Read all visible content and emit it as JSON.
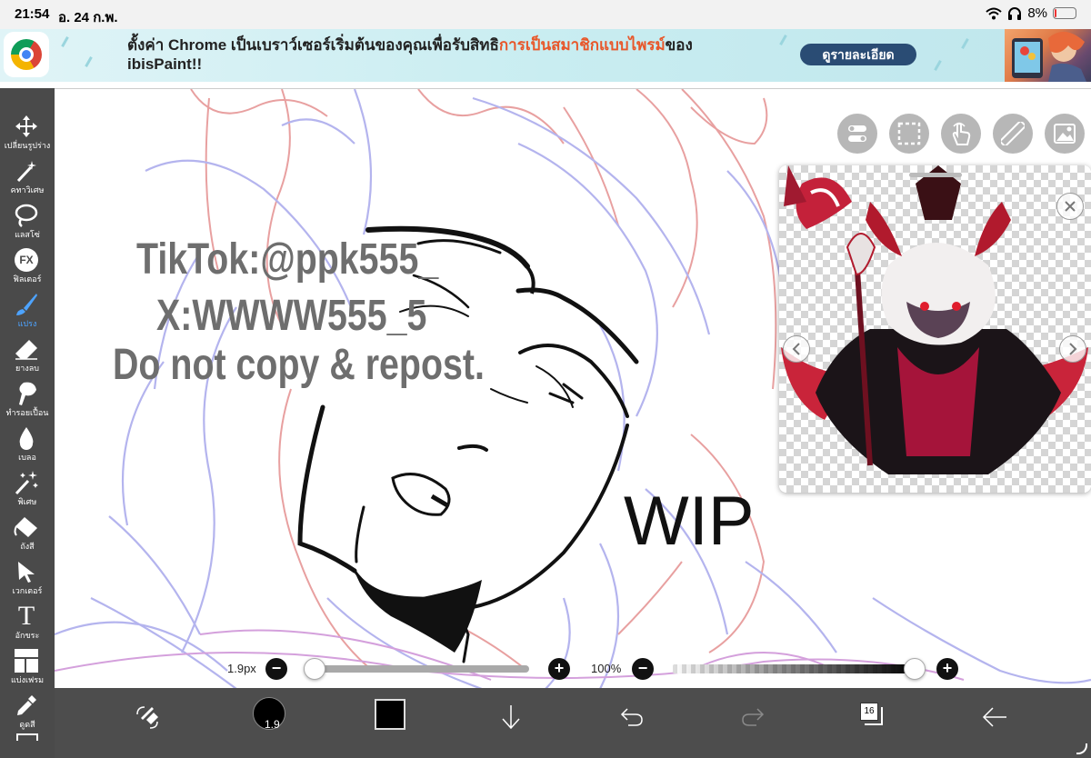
{
  "status_bar": {
    "time": "21:54",
    "date": "อ. 24 ก.พ.",
    "battery": "8%",
    "battery_level": 0.08
  },
  "ad_banner": {
    "text_part1": "ตั้งค่า Chrome เป็นเบราว์เซอร์เริ่มต้นของคุณเพื่อรับสิทธิ",
    "text_highlight": "การเป็นสมาชิกแบบไพรม์",
    "text_part2": "ของ",
    "text_line2": "ibisPaint!!",
    "button_label": "ดูรายละเอียด",
    "highlight_color": "#e8572a"
  },
  "toolbar": {
    "items": [
      {
        "label": "เปลี่ยนรูปร่าง",
        "icon": "move-icon"
      },
      {
        "label": "คทาวิเศษ",
        "icon": "magic-wand-icon"
      },
      {
        "label": "แลสโซ่",
        "icon": "lasso-icon"
      },
      {
        "label": "ฟิลเตอร์",
        "icon": "fx-icon",
        "glyph": "FX"
      },
      {
        "label": "แปรง",
        "icon": "brush-icon",
        "active": true
      },
      {
        "label": "ยางลบ",
        "icon": "eraser-icon"
      },
      {
        "label": "ทำรอยเปื้อน",
        "icon": "smudge-icon"
      },
      {
        "label": "เบลอ",
        "icon": "blur-icon"
      },
      {
        "label": "พิเศษ",
        "icon": "special-icon"
      },
      {
        "label": "ถังสี",
        "icon": "bucket-icon"
      },
      {
        "label": "เวกเตอร์",
        "icon": "vector-icon"
      },
      {
        "label": "อักขระ",
        "icon": "text-icon",
        "glyph": "T"
      },
      {
        "label": "แบ่งเฟรม",
        "icon": "frame-icon"
      },
      {
        "label": "ดูดสี",
        "icon": "eyedropper-icon"
      }
    ],
    "active_color": "#4da3ff"
  },
  "canvas": {
    "watermark_line1": "TikTok:@ppk555_",
    "watermark_line2": "X:WWWW555_5",
    "watermark_line3": "Do not copy & repost.",
    "wip_text": "WIP"
  },
  "brush_size": {
    "label": "1.9px",
    "value_fraction": 0.0,
    "minus": "−",
    "plus": "+"
  },
  "opacity": {
    "label": "100%",
    "value_fraction": 1.0,
    "minus": "−",
    "plus": "+"
  },
  "bottom_bar": {
    "brush_size_badge": "1.9",
    "color": "#000000",
    "layer_count": "16"
  }
}
